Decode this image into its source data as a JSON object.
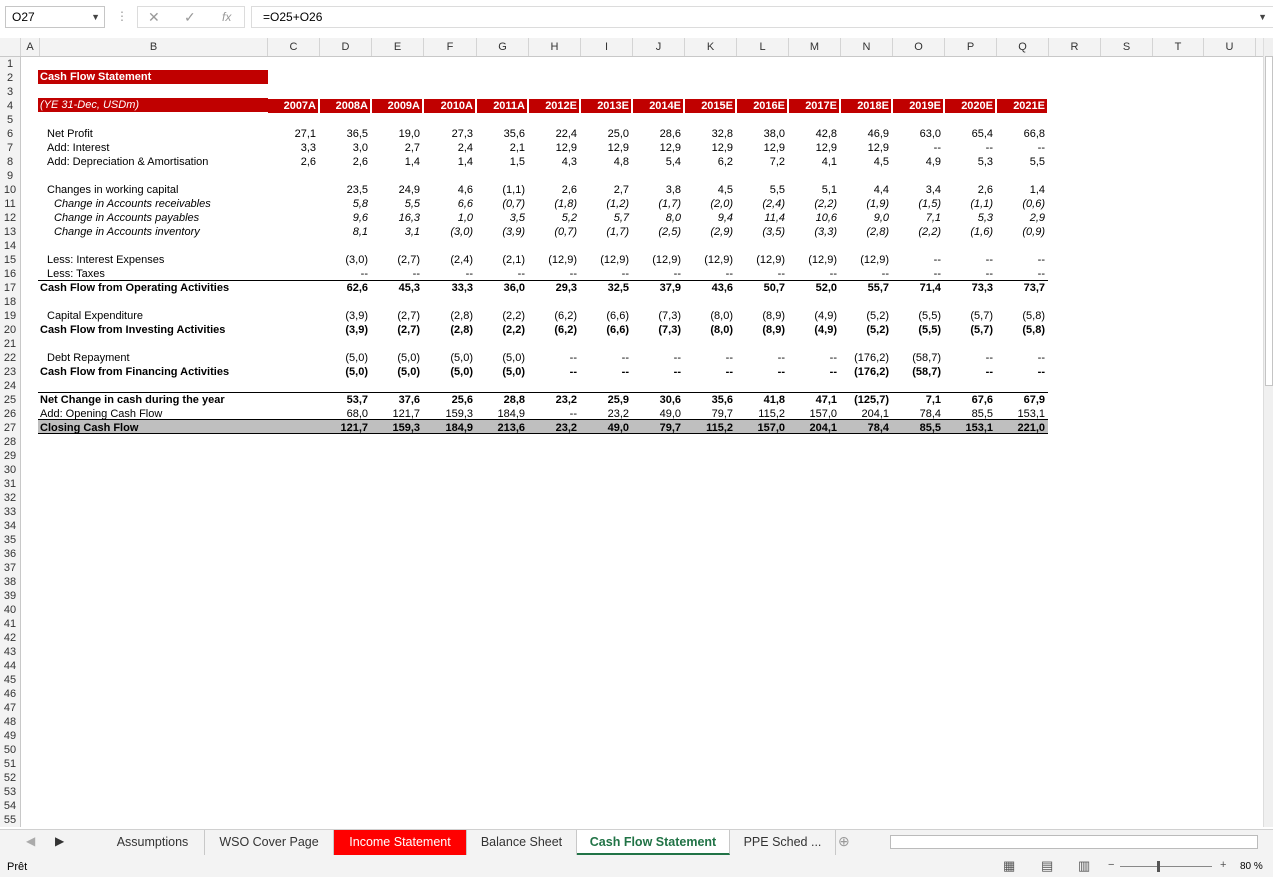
{
  "formula_bar": {
    "name_box": "O27",
    "fx_label": "fx",
    "formula": "=O25+O26"
  },
  "columns": [
    "A",
    "B",
    "C",
    "D",
    "E",
    "F",
    "G",
    "H",
    "I",
    "J",
    "K",
    "L",
    "M",
    "N",
    "O",
    "P",
    "Q",
    "R",
    "S",
    "T",
    "U"
  ],
  "rows": [
    "1",
    "2",
    "3",
    "4",
    "5",
    "6",
    "7",
    "8",
    "9",
    "10",
    "11",
    "12",
    "13",
    "14",
    "15",
    "16",
    "17",
    "18",
    "19",
    "20",
    "21",
    "22",
    "23",
    "24",
    "25",
    "26",
    "27",
    "28",
    "29",
    "30",
    "31",
    "32",
    "33",
    "34",
    "35",
    "36",
    "37",
    "38",
    "39",
    "40",
    "41",
    "42",
    "43",
    "44",
    "45",
    "46",
    "47",
    "48",
    "49",
    "50",
    "51",
    "52",
    "53",
    "54",
    "55"
  ],
  "sheet": {
    "title": "Cash Flow Statement",
    "period_label": "(YE 31-Dec, USDm)",
    "years": [
      "2007A",
      "2008A",
      "2009A",
      "2010A",
      "2011A",
      "2012E",
      "2013E",
      "2014E",
      "2015E",
      "2016E",
      "2017E",
      "2018E",
      "2019E",
      "2020E",
      "2021E"
    ],
    "lines": [
      {
        "label": "Net Profit",
        "row": 5,
        "indent": true,
        "style": "",
        "values": [
          "27,1",
          "36,5",
          "19,0",
          "27,3",
          "35,6",
          "22,4",
          "25,0",
          "28,6",
          "32,8",
          "38,0",
          "42,8",
          "46,9",
          "63,0",
          "65,4",
          "66,8"
        ]
      },
      {
        "label": "Add: Interest",
        "row": 6,
        "indent": true,
        "style": "",
        "values": [
          "3,3",
          "3,0",
          "2,7",
          "2,4",
          "2,1",
          "12,9",
          "12,9",
          "12,9",
          "12,9",
          "12,9",
          "12,9",
          "12,9",
          "--",
          "--",
          "--"
        ]
      },
      {
        "label": "Add: Depreciation & Amortisation",
        "row": 7,
        "indent": true,
        "style": "",
        "values": [
          "2,6",
          "2,6",
          "1,4",
          "1,4",
          "1,5",
          "4,3",
          "4,8",
          "5,4",
          "6,2",
          "7,2",
          "4,1",
          "4,5",
          "4,9",
          "5,3",
          "5,5"
        ]
      },
      {
        "label": "Changes in working capital",
        "row": 9,
        "indent": true,
        "style": "",
        "values": [
          "",
          "23,5",
          "24,9",
          "4,6",
          "(1,1)",
          "2,6",
          "2,7",
          "3,8",
          "4,5",
          "5,5",
          "5,1",
          "4,4",
          "3,4",
          "2,6",
          "1,4"
        ]
      },
      {
        "label": "Change in Accounts receivables",
        "row": 10,
        "indent": "2",
        "style": "i",
        "values": [
          "",
          "5,8",
          "5,5",
          "6,6",
          "(0,7)",
          "(1,8)",
          "(1,2)",
          "(1,7)",
          "(2,0)",
          "(2,4)",
          "(2,2)",
          "(1,9)",
          "(1,5)",
          "(1,1)",
          "(0,6)"
        ]
      },
      {
        "label": "Change in Accounts payables",
        "row": 11,
        "indent": "2",
        "style": "i",
        "values": [
          "",
          "9,6",
          "16,3",
          "1,0",
          "3,5",
          "5,2",
          "5,7",
          "8,0",
          "9,4",
          "11,4",
          "10,6",
          "9,0",
          "7,1",
          "5,3",
          "2,9"
        ]
      },
      {
        "label": "Change in Accounts inventory",
        "row": 12,
        "indent": "2",
        "style": "i",
        "values": [
          "",
          "8,1",
          "3,1",
          "(3,0)",
          "(3,9)",
          "(0,7)",
          "(1,7)",
          "(2,5)",
          "(2,9)",
          "(3,5)",
          "(3,3)",
          "(2,8)",
          "(2,2)",
          "(1,6)",
          "(0,9)"
        ]
      },
      {
        "label": "Less: Interest Expenses",
        "row": 14,
        "indent": true,
        "style": "",
        "values": [
          "",
          "(3,0)",
          "(2,7)",
          "(2,4)",
          "(2,1)",
          "(12,9)",
          "(12,9)",
          "(12,9)",
          "(12,9)",
          "(12,9)",
          "(12,9)",
          "(12,9)",
          "--",
          "--",
          "--"
        ]
      },
      {
        "label": "Less: Taxes",
        "row": 15,
        "indent": true,
        "style": "",
        "values": [
          "",
          "--",
          "--",
          "--",
          "--",
          "--",
          "--",
          "--",
          "--",
          "--",
          "--",
          "--",
          "--",
          "--",
          "--"
        ]
      },
      {
        "label": "Cash Flow from Operating Activities",
        "row": 16,
        "indent": false,
        "style": "b",
        "values": [
          "",
          "62,6",
          "45,3",
          "33,3",
          "36,0",
          "29,3",
          "32,5",
          "37,9",
          "43,6",
          "50,7",
          "52,0",
          "55,7",
          "71,4",
          "73,3",
          "73,7"
        ]
      },
      {
        "label": "Capital Expenditure",
        "row": 18,
        "indent": true,
        "style": "",
        "values": [
          "",
          "(3,9)",
          "(2,7)",
          "(2,8)",
          "(2,2)",
          "(6,2)",
          "(6,6)",
          "(7,3)",
          "(8,0)",
          "(8,9)",
          "(4,9)",
          "(5,2)",
          "(5,5)",
          "(5,7)",
          "(5,8)"
        ]
      },
      {
        "label": "Cash Flow from Investing Activities",
        "row": 19,
        "indent": false,
        "style": "b",
        "values": [
          "",
          "(3,9)",
          "(2,7)",
          "(2,8)",
          "(2,2)",
          "(6,2)",
          "(6,6)",
          "(7,3)",
          "(8,0)",
          "(8,9)",
          "(4,9)",
          "(5,2)",
          "(5,5)",
          "(5,7)",
          "(5,8)"
        ]
      },
      {
        "label": "Debt Repayment",
        "row": 21,
        "indent": true,
        "style": "",
        "values": [
          "",
          "(5,0)",
          "(5,0)",
          "(5,0)",
          "(5,0)",
          "--",
          "--",
          "--",
          "--",
          "--",
          "--",
          "(176,2)",
          "(58,7)",
          "--",
          "--"
        ]
      },
      {
        "label": "Cash Flow from Financing Activities",
        "row": 22,
        "indent": false,
        "style": "b",
        "values": [
          "",
          "(5,0)",
          "(5,0)",
          "(5,0)",
          "(5,0)",
          "--",
          "--",
          "--",
          "--",
          "--",
          "--",
          "(176,2)",
          "(58,7)",
          "--",
          "--"
        ]
      },
      {
        "label": "Net Change in cash during the year",
        "row": 24,
        "indent": false,
        "style": "b",
        "values": [
          "",
          "53,7",
          "37,6",
          "25,6",
          "28,8",
          "23,2",
          "25,9",
          "30,6",
          "35,6",
          "41,8",
          "47,1",
          "(125,7)",
          "7,1",
          "67,6",
          "67,9"
        ]
      },
      {
        "label": "Add: Opening Cash Flow",
        "row": 25,
        "indent": false,
        "style": "",
        "values": [
          "",
          "68,0",
          "121,7",
          "159,3",
          "184,9",
          "--",
          "23,2",
          "49,0",
          "79,7",
          "115,2",
          "157,0",
          "204,1",
          "78,4",
          "85,5",
          "153,1"
        ]
      },
      {
        "label": "Closing Cash Flow",
        "row": 26,
        "indent": false,
        "style": "b",
        "values": [
          "",
          "121,7",
          "159,3",
          "184,9",
          "213,6",
          "23,2",
          "49,0",
          "79,7",
          "115,2",
          "157,0",
          "204,1",
          "78,4",
          "85,5",
          "153,1",
          "221,0"
        ]
      }
    ]
  },
  "tabs": [
    {
      "label": "Assumptions",
      "state": "normal"
    },
    {
      "label": "WSO Cover Page",
      "state": "normal"
    },
    {
      "label": "Income Statement",
      "state": "red"
    },
    {
      "label": "Balance Sheet",
      "state": "normal"
    },
    {
      "label": "Cash Flow Statement",
      "state": "active"
    },
    {
      "label": "PPE Sched ...",
      "state": "normal"
    }
  ],
  "status": {
    "text": "Prêt",
    "zoom": "80 %"
  },
  "colors": {
    "header_red": "#c00000",
    "active_tab": "#217346",
    "tab_red": "#ff0000"
  }
}
